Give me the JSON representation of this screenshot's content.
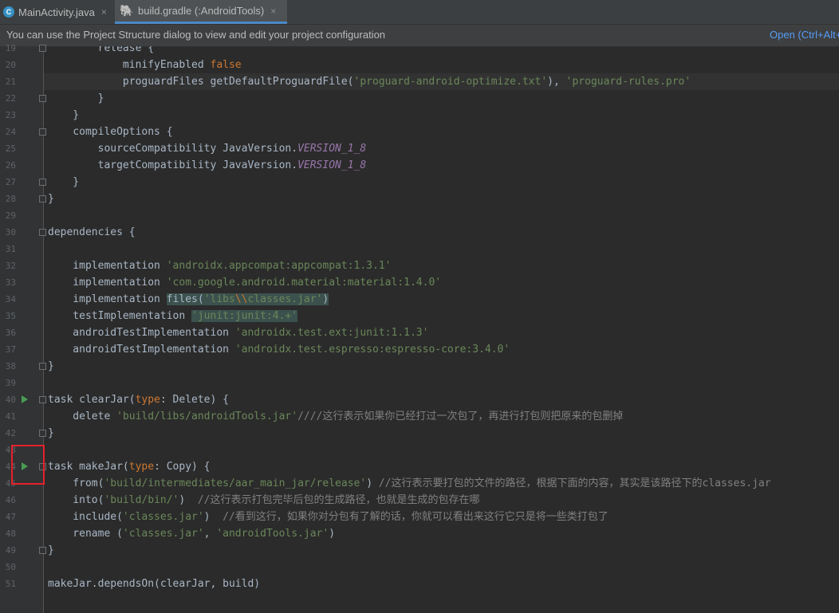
{
  "tabs": [
    {
      "label": "MainActivity.java",
      "icon": "java-class-icon",
      "icon_glyph": "C"
    },
    {
      "label": "build.gradle (:AndroidTools)",
      "icon": "gradle-icon",
      "icon_glyph": "🐘"
    }
  ],
  "tab_close_glyph": "×",
  "notice": {
    "text": "You can use the Project Structure dialog to view and edit your project configuration",
    "link": "Open (Ctrl+Alt+"
  },
  "lines": [
    {
      "n": "19",
      "t": [
        {
          "x": "        release {"
        }
      ]
    },
    {
      "n": "20",
      "t": [
        {
          "x": "            minifyEnabled "
        },
        {
          "x": "false",
          "c": "k"
        }
      ]
    },
    {
      "n": "21",
      "t": [
        {
          "x": "            proguardFiles getDefaultProguardFile("
        },
        {
          "x": "'proguard-android-optimize.txt'",
          "c": "s"
        },
        {
          "x": "), "
        },
        {
          "x": "'proguard-rules.pro'",
          "c": "s"
        }
      ]
    },
    {
      "n": "22",
      "t": [
        {
          "x": "        }"
        }
      ]
    },
    {
      "n": "23",
      "t": [
        {
          "x": "    }"
        }
      ]
    },
    {
      "n": "24",
      "t": [
        {
          "x": "    compileOptions {"
        }
      ]
    },
    {
      "n": "25",
      "t": [
        {
          "x": "        sourceCompatibility JavaVersion."
        },
        {
          "x": "VERSION_1_8",
          "c": "p"
        }
      ]
    },
    {
      "n": "26",
      "t": [
        {
          "x": "        targetCompatibility JavaVersion."
        },
        {
          "x": "VERSION_1_8",
          "c": "p"
        }
      ]
    },
    {
      "n": "27",
      "t": [
        {
          "x": "    }"
        }
      ]
    },
    {
      "n": "28",
      "t": [
        {
          "x": "}"
        }
      ]
    },
    {
      "n": "29",
      "t": [
        {
          "x": ""
        }
      ]
    },
    {
      "n": "30",
      "t": [
        {
          "x": "dependencies {"
        }
      ]
    },
    {
      "n": "31",
      "t": [
        {
          "x": ""
        }
      ]
    },
    {
      "n": "32",
      "t": [
        {
          "x": "    implementation "
        },
        {
          "x": "'androidx.appcompat:appcompat:1.3.1'",
          "c": "s"
        }
      ]
    },
    {
      "n": "33",
      "t": [
        {
          "x": "    implementation "
        },
        {
          "x": "'com.google.android.material:material:1.4.0'",
          "c": "s"
        }
      ]
    },
    {
      "n": "34",
      "t": [
        {
          "x": "    implementation "
        },
        {
          "x": "files(",
          "c": "bgm"
        },
        {
          "x": "'libs",
          "c": "s bgm"
        },
        {
          "x": "\\\\",
          "c": "k bgm"
        },
        {
          "x": "classes.jar'",
          "c": "s bgm"
        },
        {
          "x": ")",
          "c": "bgm"
        }
      ]
    },
    {
      "n": "35",
      "t": [
        {
          "x": "    testImplementation "
        },
        {
          "x": "'junit:junit:4.+'",
          "c": "s bgm"
        }
      ]
    },
    {
      "n": "36",
      "t": [
        {
          "x": "    androidTestImplementation "
        },
        {
          "x": "'androidx.test.ext:junit:1.1.3'",
          "c": "s"
        }
      ]
    },
    {
      "n": "37",
      "t": [
        {
          "x": "    androidTestImplementation "
        },
        {
          "x": "'androidx.test.espresso:espresso-core:3.4.0'",
          "c": "s"
        }
      ]
    },
    {
      "n": "38",
      "t": [
        {
          "x": "}"
        }
      ]
    },
    {
      "n": "39",
      "t": [
        {
          "x": ""
        }
      ]
    },
    {
      "n": "40",
      "t": [
        {
          "x": "task clearJar("
        },
        {
          "x": "type",
          "c": "k"
        },
        {
          "x": ": Delete) {"
        }
      ]
    },
    {
      "n": "41",
      "t": [
        {
          "x": "    delete "
        },
        {
          "x": "'build/libs/androidTools.jar'",
          "c": "s"
        },
        {
          "x": "////这行表示如果你已经打过一次包了，再进行打包则把原来的包删掉",
          "c": "c"
        }
      ]
    },
    {
      "n": "42",
      "t": [
        {
          "x": "}"
        }
      ]
    },
    {
      "n": "43",
      "t": [
        {
          "x": ""
        }
      ]
    },
    {
      "n": "44",
      "t": [
        {
          "x": "task makeJar("
        },
        {
          "x": "type",
          "c": "k"
        },
        {
          "x": ": Copy) {"
        }
      ]
    },
    {
      "n": "45",
      "t": [
        {
          "x": "    from("
        },
        {
          "x": "'build/intermediates/aar_main_jar/release'",
          "c": "s"
        },
        {
          "x": ") "
        },
        {
          "x": "//这行表示要打包的文件的路径，根据下面的内容，其实是该路径下的classes.jar",
          "c": "c"
        }
      ]
    },
    {
      "n": "46",
      "t": [
        {
          "x": "    into("
        },
        {
          "x": "'build/bin/'",
          "c": "s"
        },
        {
          "x": ")  "
        },
        {
          "x": "//这行表示打包完毕后包的生成路径，也就是生成的包存在哪",
          "c": "c"
        }
      ]
    },
    {
      "n": "47",
      "t": [
        {
          "x": "    include("
        },
        {
          "x": "'classes.jar'",
          "c": "s"
        },
        {
          "x": ")  "
        },
        {
          "x": "//看到这行，如果你对分包有了解的话，你就可以看出来这行它只是将一些类打包了",
          "c": "c"
        }
      ]
    },
    {
      "n": "48",
      "t": [
        {
          "x": "    rename ("
        },
        {
          "x": "'classes.jar'",
          "c": "s"
        },
        {
          "x": ", "
        },
        {
          "x": "'androidTools.jar'",
          "c": "s"
        },
        {
          "x": ")"
        }
      ]
    },
    {
      "n": "49",
      "t": [
        {
          "x": "}"
        }
      ]
    },
    {
      "n": "50",
      "t": [
        {
          "x": ""
        }
      ]
    },
    {
      "n": "51",
      "t": [
        {
          "x": "makeJar.dependsOn(clearJar, build)"
        }
      ]
    }
  ],
  "highlight_line": "21",
  "fold_lines": [
    "19",
    "22",
    "24",
    "27",
    "28",
    "30",
    "38",
    "40",
    "42",
    "44",
    "49"
  ],
  "run_lines": [
    "40",
    "44"
  ],
  "highlighted_run_line": "44"
}
